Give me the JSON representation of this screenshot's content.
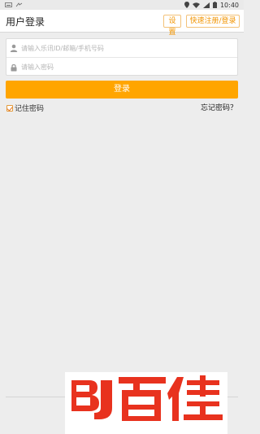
{
  "statusbar": {
    "time": "10:40"
  },
  "header": {
    "title": "用户登录",
    "settings_label": "设置",
    "register_label": "快速注册/登录"
  },
  "form": {
    "username_placeholder": "请输入乐讯ID/邮箱/手机号码",
    "password_placeholder": "请输入密码",
    "username_value": "",
    "password_value": ""
  },
  "actions": {
    "login_label": "登录",
    "remember_label": "记住密码",
    "remember_checked": true,
    "forgot_label": "忘记密码？"
  },
  "footer": {
    "logo_text": "百佳"
  },
  "colors": {
    "accent": "#ffa500",
    "logo_red": "#e8321e"
  },
  "icons": {
    "user": "user-icon",
    "lock": "lock-icon"
  }
}
